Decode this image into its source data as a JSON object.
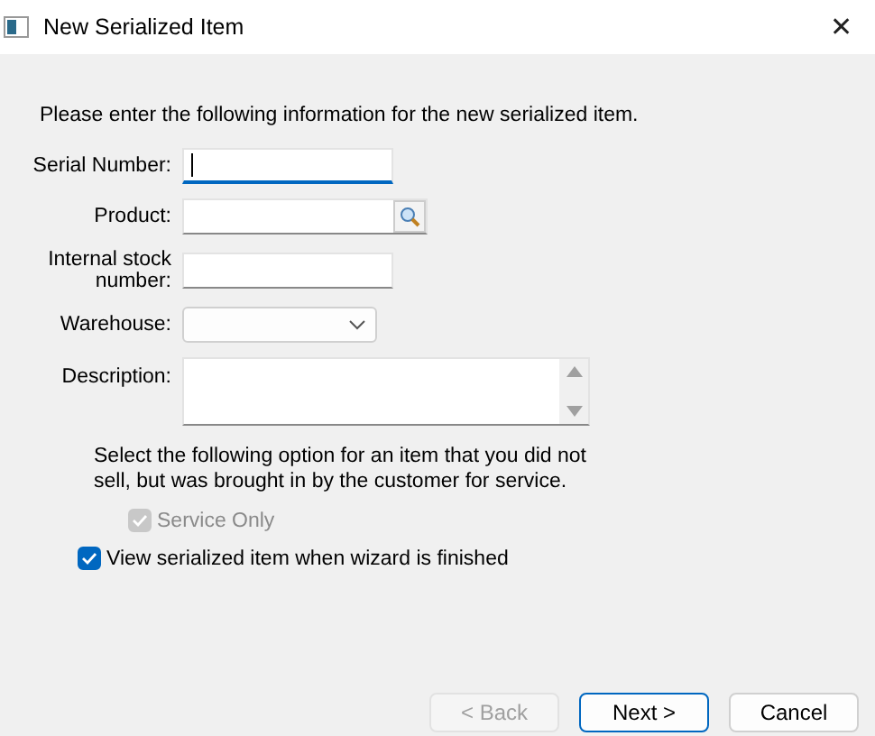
{
  "window": {
    "title": "New Serialized Item",
    "close": "✕"
  },
  "intro": "Please enter the following information for the new serialized item.",
  "fields": [
    {
      "kind": "text",
      "label": "Serial Number:",
      "focused": true
    },
    {
      "kind": "lookup",
      "label": "Product:",
      "focused": false
    },
    {
      "kind": "text",
      "label": "Internal stock number:",
      "focused": false
    },
    {
      "kind": "combo",
      "label": "Warehouse:",
      "focused": false
    },
    {
      "kind": "memo",
      "label": "Description:",
      "focused": false
    }
  ],
  "note": "Select the following option for an item that you did not sell, but was brought in by the customer for service.",
  "checkboxes": [
    {
      "label": "Service Only",
      "checked": true,
      "disabled": true,
      "indent": true
    },
    {
      "label": "View serialized item when wizard is finished",
      "checked": true,
      "disabled": false,
      "indent": false
    }
  ],
  "buttons": [
    {
      "label": "< Back",
      "disabled": true,
      "default": false
    },
    {
      "label": "Next >",
      "disabled": false,
      "default": true
    },
    {
      "label": "Cancel",
      "disabled": false,
      "default": false
    }
  ]
}
